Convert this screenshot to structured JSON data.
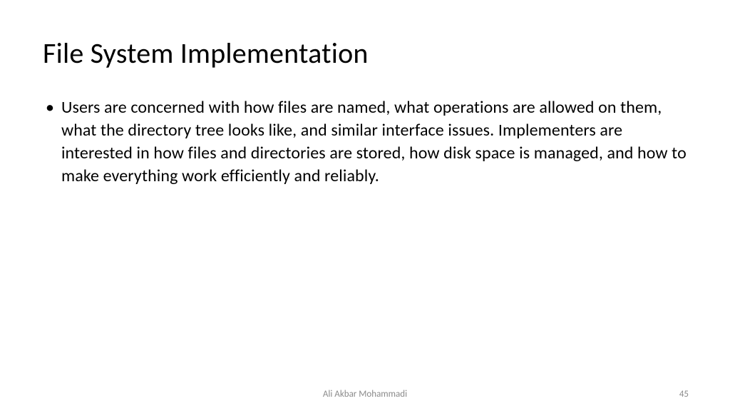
{
  "slide": {
    "title": "File System Implementation",
    "bullets": [
      "Users are concerned with how files are named, what operations are allowed on them, what the directory tree looks like, and similar interface issues. Implementers are interested in how files and directories are stored, how disk space is managed, and how to make everything work efficiently and reliably."
    ],
    "footer": {
      "author": "Ali Akbar Mohammadi",
      "page_number": "45"
    }
  }
}
